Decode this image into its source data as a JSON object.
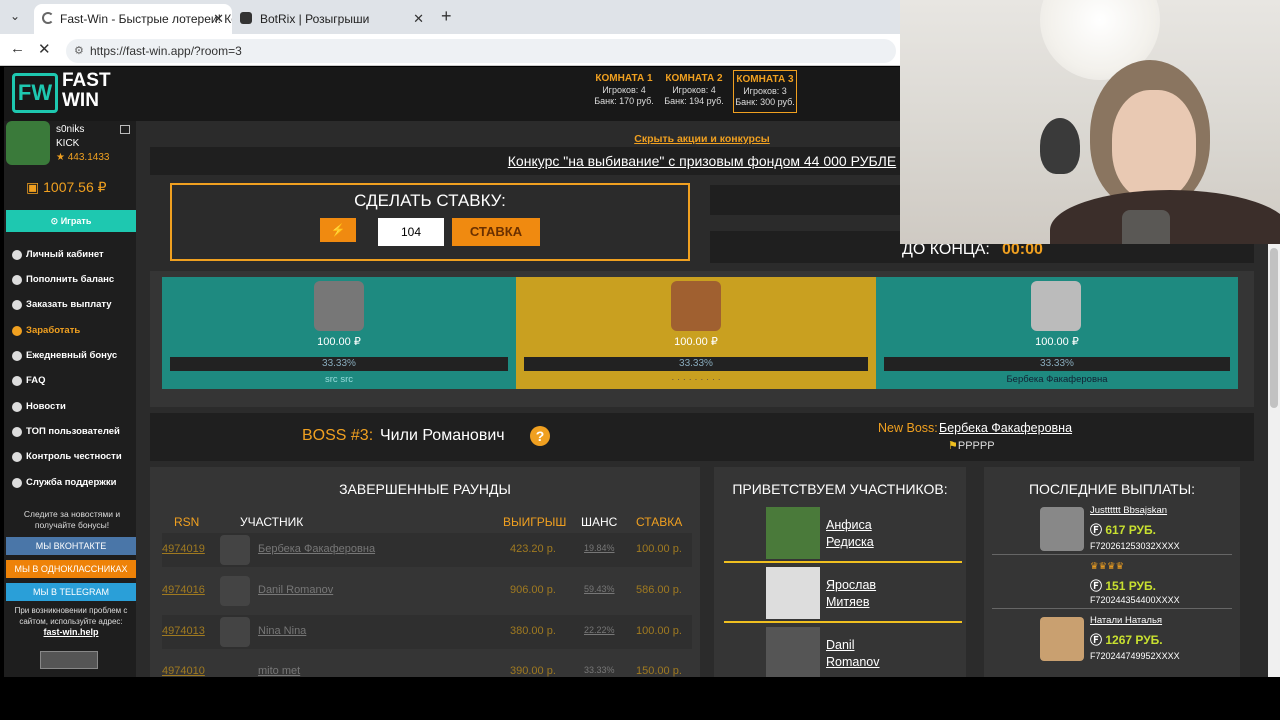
{
  "browser": {
    "tabs": [
      {
        "label": "Fast-Win - Быстрые лотереи! Ком"
      },
      {
        "label": "BotRix | Розыгрыши"
      }
    ],
    "url": "https://fast-win.app/?room=3"
  },
  "site": {
    "logo": {
      "line1": "FAST",
      "line2": "WIN"
    },
    "user": {
      "name": "s0niks",
      "platform": "KICK",
      "rating": "★ 443.1433"
    },
    "balance": "1007.56 ₽",
    "play_label": "Играть",
    "rooms": [
      {
        "title": "КОМНАТА 1",
        "players": "Игроков: 4",
        "bank": "Банк: 170 руб."
      },
      {
        "title": "КОМНАТА 2",
        "players": "Игроков: 4",
        "bank": "Банк: 194 руб."
      },
      {
        "title": "КОМНАТА 3",
        "players": "Игроков: 3",
        "bank": "Банк: 300 руб."
      }
    ],
    "menu": [
      {
        "label": "Личный кабинет"
      },
      {
        "label": "Пополнить баланс"
      },
      {
        "label": "Заказать выплату"
      },
      {
        "label": "Заработать"
      },
      {
        "label": "Ежедневный бонус"
      },
      {
        "label": "FAQ"
      },
      {
        "label": "Новости"
      },
      {
        "label": "ТОП пользователей"
      },
      {
        "label": "Контроль честности"
      },
      {
        "label": "Служба поддержки"
      }
    ],
    "social": {
      "text": "Следите за новостями и получайте бонусы!",
      "vk": "МЫ ВКОНТАКТЕ",
      "ok": "МЫ В ОДНОКЛАССНИКАХ",
      "tg": "МЫ В TELEGRAM",
      "help_text": "При возникновении проблем с сайтом, используйте адрес:",
      "help_link": "fast-win.help"
    },
    "hide_promos": "Скрыть акции и конкурсы",
    "contest": "Конкурс \"на выбивание\" с призовым фондом 44 000 РУБЛЕ",
    "bet": {
      "title": "СДЕЛАТЬ СТАВКУ:",
      "amount": "104",
      "button": "СТАВКА"
    },
    "countdown": {
      "label": "ДО КОНЦА:",
      "value": "00:00"
    },
    "players": [
      {
        "amount": "100.00 ₽",
        "chance": "33.33%",
        "name": "src src"
      },
      {
        "amount": "100.00 ₽",
        "chance": "33.33%",
        "name": "· · · · · · · · ·"
      },
      {
        "amount": "100.00 ₽",
        "chance": "33.33%",
        "name": "Бербека Факаферовна"
      }
    ],
    "boss": {
      "label": "BOSS #3:",
      "name": "Чили Романович",
      "new_label": "New Boss:",
      "new_name": "Бербека Факаферовна",
      "flag": "PPPPP"
    },
    "rounds": {
      "title": "ЗАВЕРШЕННЫЕ РАУНДЫ",
      "headers": {
        "rsn": "RSN",
        "player": "УЧАСТНИК",
        "win": "ВЫИГРЫШ",
        "chance": "ШАНС",
        "bet": "СТАВКА"
      },
      "rows": [
        {
          "rsn": "4974019",
          "name": "Бербека Факаферовна",
          "win": "423.20 р.",
          "chance": "19.84%",
          "bet": "100.00 р."
        },
        {
          "rsn": "4974016",
          "name": "Danil Romanov",
          "win": "906.00 р.",
          "chance": "59.43%",
          "bet": "586.00 р."
        },
        {
          "rsn": "4974013",
          "name": "Nina Nina",
          "win": "380.00 р.",
          "chance": "22.22%",
          "bet": "100.00 р."
        },
        {
          "rsn": "4974010",
          "name": "mito met",
          "win": "390.00 р.",
          "chance": "33.33%",
          "bet": "150.00 р."
        }
      ]
    },
    "welcome": {
      "title": "ПРИВЕТСТВУЕМ УЧАСТНИКОВ:",
      "items": [
        {
          "name1": "Анфиса",
          "name2": "Редиска"
        },
        {
          "name1": "Ярослав",
          "name2": "Митяев"
        },
        {
          "name1": "Danil",
          "name2": "Romanov"
        }
      ]
    },
    "payouts": {
      "title": "ПОСЛЕДНИЕ ВЫПЛАТЫ:",
      "items": [
        {
          "name": "Justttttt Bbsajskan",
          "amount": "617 РУБ.",
          "wallet": "F720261253032XXXX"
        },
        {
          "name": "",
          "amount": "151 РУБ.",
          "wallet": "F720244354400XXXX"
        },
        {
          "name": "Натали Наталья",
          "amount": "1267 РУБ.",
          "wallet": "F720244749952XXXX"
        }
      ]
    }
  }
}
